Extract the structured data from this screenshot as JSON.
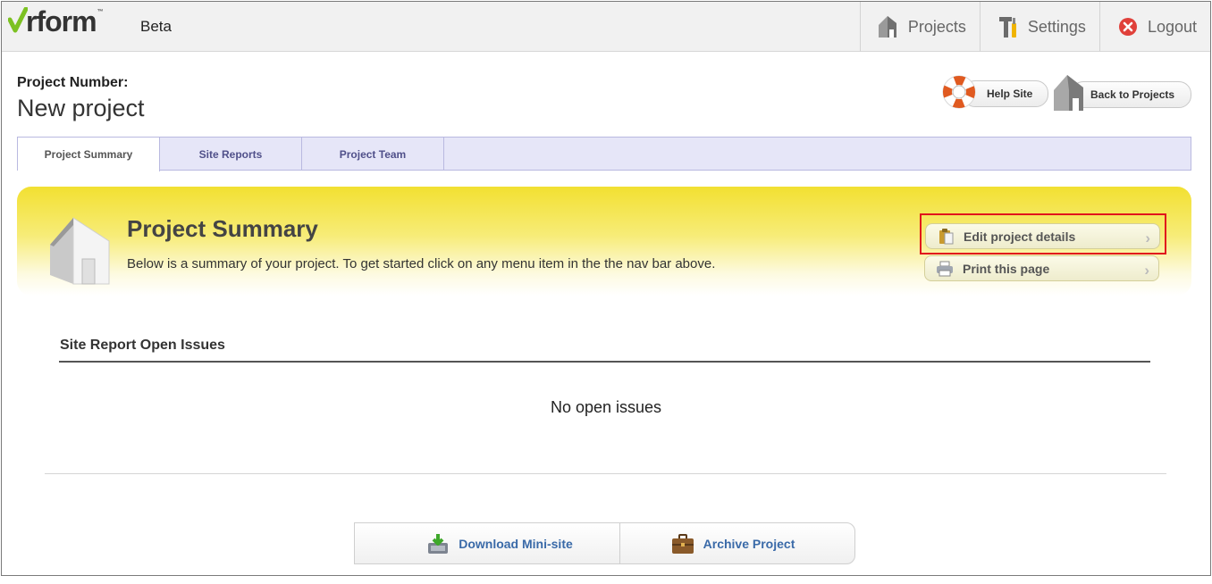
{
  "app": {
    "logo_text": "rform",
    "logo_tm": "™",
    "badge": "Beta"
  },
  "topnav": {
    "projects": "Projects",
    "settings": "Settings",
    "logout": "Logout"
  },
  "project": {
    "number_label": "Project Number:",
    "name": "New project",
    "help_site": "Help Site",
    "back_to_projects": "Back to Projects"
  },
  "tabs": [
    {
      "label": "Project Summary",
      "active": true
    },
    {
      "label": "Site Reports",
      "active": false
    },
    {
      "label": "Project Team",
      "active": false
    }
  ],
  "summary": {
    "title": "Project Summary",
    "description": "Below is a summary of your project. To get started click on any menu item in the the nav bar above.",
    "edit_label": "Edit project details",
    "print_label": "Print this page",
    "chevron": "›"
  },
  "issues": {
    "title": "Site Report Open Issues",
    "empty_text": "No open issues"
  },
  "bottom": {
    "download_label": "Download Mini-site",
    "archive_label": "Archive Project"
  },
  "colors": {
    "accent_yellow": "#f2e031",
    "tab_bg": "#e6e6f8",
    "link_blue": "#3a6aa8",
    "highlight_red": "#e1141c"
  }
}
